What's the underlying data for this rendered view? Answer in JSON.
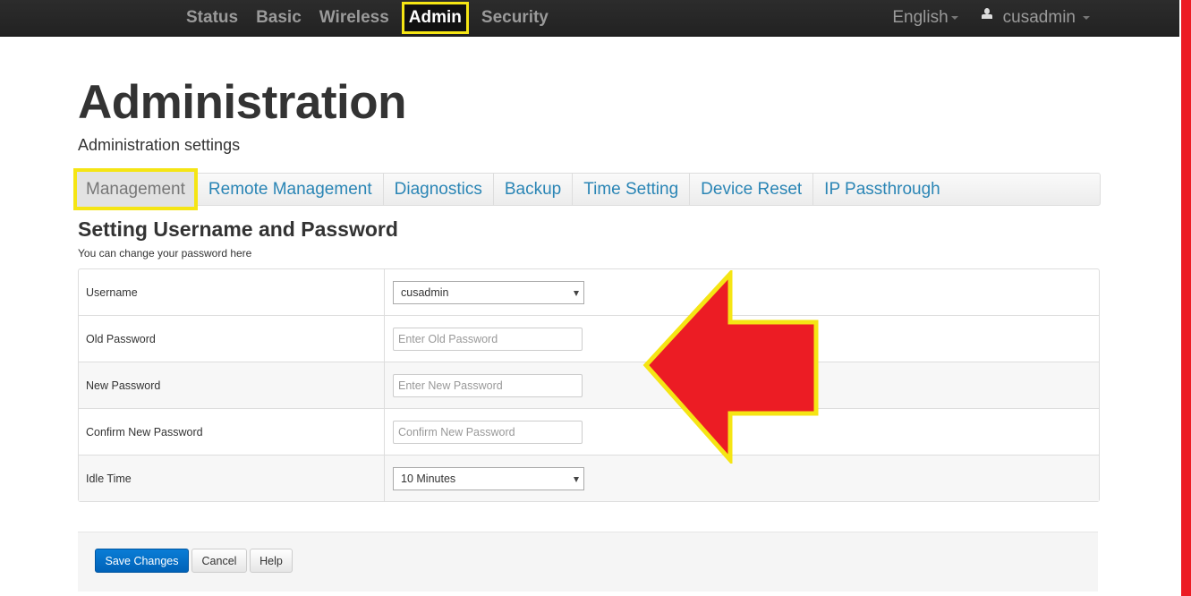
{
  "topnav": {
    "items": [
      {
        "label": "Status",
        "active": false
      },
      {
        "label": "Basic",
        "active": false
      },
      {
        "label": "Wireless",
        "active": false
      },
      {
        "label": "Admin",
        "active": true
      },
      {
        "label": "Security",
        "active": false
      }
    ],
    "language": "English",
    "user": "cusadmin"
  },
  "page": {
    "title": "Administration",
    "subtitle": "Administration settings"
  },
  "tabs": [
    {
      "label": "Management",
      "active": true
    },
    {
      "label": "Remote Management",
      "active": false
    },
    {
      "label": "Diagnostics",
      "active": false
    },
    {
      "label": "Backup",
      "active": false
    },
    {
      "label": "Time Setting",
      "active": false
    },
    {
      "label": "Device Reset",
      "active": false
    },
    {
      "label": "IP Passthrough",
      "active": false
    }
  ],
  "section": {
    "title": "Setting Username and Password",
    "description": "You can change your password here"
  },
  "form": {
    "username": {
      "label": "Username",
      "value": "cusadmin"
    },
    "old_password": {
      "label": "Old Password",
      "placeholder": "Enter Old Password",
      "value": ""
    },
    "new_password": {
      "label": "New Password",
      "placeholder": "Enter New Password",
      "value": ""
    },
    "confirm_password": {
      "label": "Confirm New Password",
      "placeholder": "Confirm New Password",
      "value": ""
    },
    "idle_time": {
      "label": "Idle Time",
      "value": "10 Minutes"
    }
  },
  "actions": {
    "save": "Save Changes",
    "cancel": "Cancel",
    "help": "Help"
  },
  "colors": {
    "highlight": "#f5e514",
    "arrow": "#ec1c24",
    "link": "#2a85b5",
    "primary": "#0a7dd6"
  }
}
